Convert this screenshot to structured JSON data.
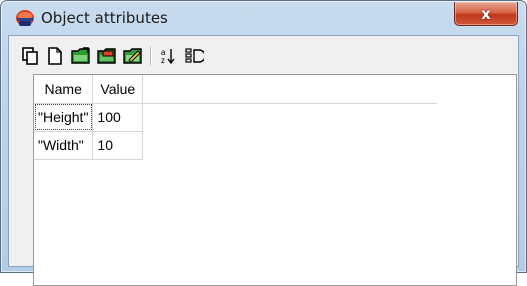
{
  "window": {
    "title": "Object attributes",
    "close_label": "x"
  },
  "toolbar": {
    "buttons": [
      {
        "name": "copy-icon",
        "tooltip": ""
      },
      {
        "name": "new-document-icon",
        "tooltip": ""
      },
      {
        "name": "import-green-icon",
        "tooltip": ""
      },
      {
        "name": "export-red-icon",
        "tooltip": ""
      },
      {
        "name": "edit-yellow-icon",
        "tooltip": ""
      },
      {
        "name": "sort-az-icon",
        "tooltip": ""
      },
      {
        "name": "filter-icon",
        "tooltip": ""
      }
    ]
  },
  "table": {
    "headers": [
      "Name",
      "Value"
    ],
    "rows": [
      {
        "name": "\"Height\"",
        "value": "100"
      },
      {
        "name": "\"Width\"",
        "value": "10"
      }
    ]
  },
  "colors": {
    "titlebar": "#bcd3ea",
    "close_button": "#c1371c",
    "client_bg": "#f0f0f0",
    "grid_line": "#d6d6d6"
  }
}
